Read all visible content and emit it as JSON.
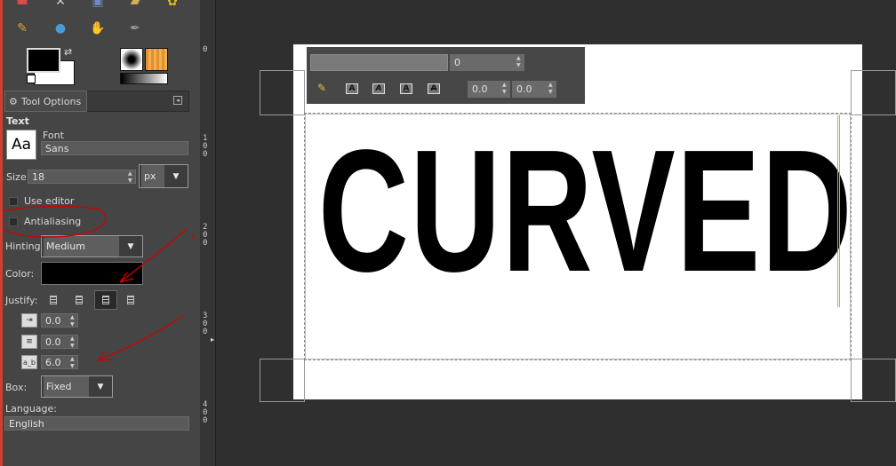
{
  "tool_options": {
    "tab_label": "Tool Options",
    "section_title": "Text",
    "font_label": "Font",
    "font_value": "Sans",
    "font_preview": "Aa",
    "size_label": "Size:",
    "size_value": "18",
    "size_unit": "px",
    "use_editor_label": "Use editor",
    "antialiasing_label": "Antialiasing",
    "hinting_label": "Hinting:",
    "hinting_value": "Medium",
    "color_label": "Color:",
    "justify_label": "Justify:",
    "indent_value": "0.0",
    "line_spacing_value": "0.0",
    "letter_spacing_value": "6.0",
    "box_label": "Box:",
    "box_value": "Fixed",
    "language_label": "Language:",
    "language_value": "English"
  },
  "ruler": {
    "marks": [
      "0",
      "100",
      "200",
      "300",
      "400"
    ]
  },
  "text_toolbar": {
    "font_field": "",
    "size_field": "0",
    "baseline_value": "0.0",
    "kerning_value": "0.0"
  },
  "canvas": {
    "text": "CURVED"
  },
  "colors": {
    "foreground": "#000000",
    "background": "#ffffff",
    "text_color": "#000000",
    "annotation": "#d00000"
  }
}
